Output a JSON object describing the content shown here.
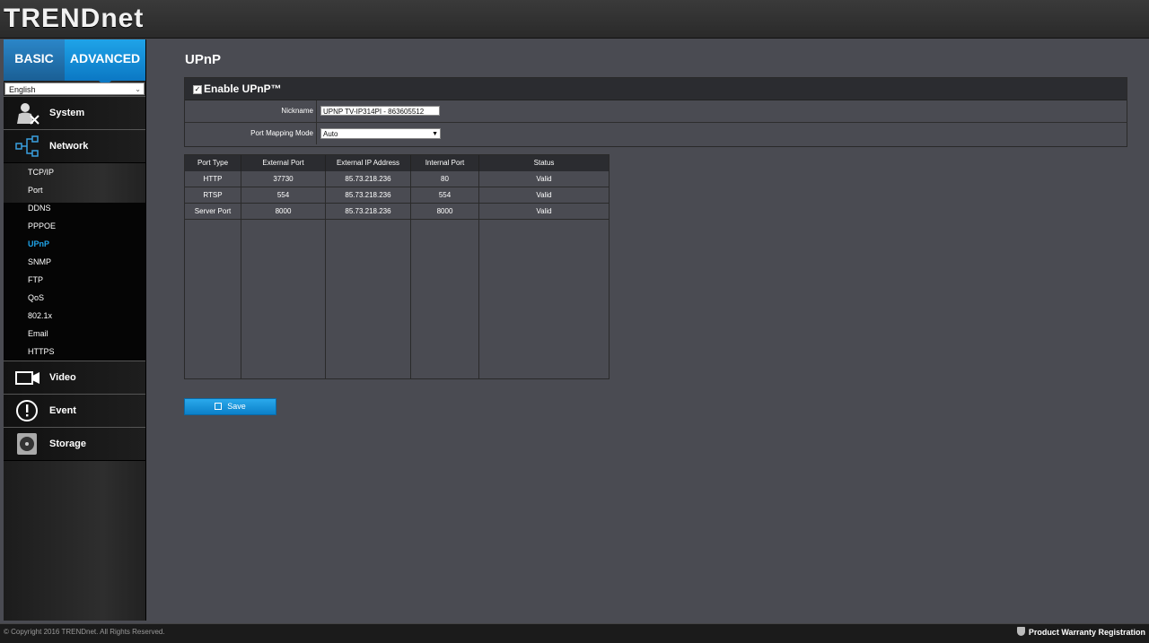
{
  "brand": {
    "logo_text": "TRENDnet"
  },
  "sidebar": {
    "mode_tabs": {
      "basic": "BASIC",
      "advanced": "ADVANCED"
    },
    "language": "English",
    "sections": [
      {
        "label": "System",
        "icon": "system-icon"
      },
      {
        "label": "Network",
        "icon": "network-icon"
      },
      {
        "label": "Video",
        "icon": "video-camera-icon"
      },
      {
        "label": "Event",
        "icon": "alert-icon"
      },
      {
        "label": "Storage",
        "icon": "storage-disk-icon"
      }
    ],
    "network_items": [
      "TCP/IP",
      "Port",
      "DDNS",
      "PPPOE",
      "UPnP",
      "SNMP",
      "FTP",
      "QoS",
      "802.1x",
      "Email",
      "HTTPS"
    ],
    "active_item": "UPnP"
  },
  "main": {
    "title": "UPnP",
    "enable_label": "Enable UPnP™",
    "enable_checked": true,
    "nickname_label": "Nickname",
    "nickname_value": "UPNP TV-IP314PI - 863605512",
    "port_mapping_label": "Port Mapping Mode",
    "port_mapping_value": "Auto",
    "table": {
      "headers": [
        "Port Type",
        "External Port",
        "External IP Address",
        "Internal Port",
        "Status"
      ],
      "rows": [
        [
          "HTTP",
          "37730",
          "85.73.218.236",
          "80",
          "Valid"
        ],
        [
          "RTSP",
          "554",
          "85.73.218.236",
          "554",
          "Valid"
        ],
        [
          "Server Port",
          "8000",
          "85.73.218.236",
          "8000",
          "Valid"
        ]
      ]
    },
    "save_label": "Save"
  },
  "footer": {
    "copyright": "© Copyright 2016 TRENDnet. All Rights Reserved.",
    "warranty": "Product Warranty Registration"
  },
  "colors": {
    "accent": "#1fa3e8",
    "background": "#4a4b52",
    "header": "#2b2c30"
  }
}
